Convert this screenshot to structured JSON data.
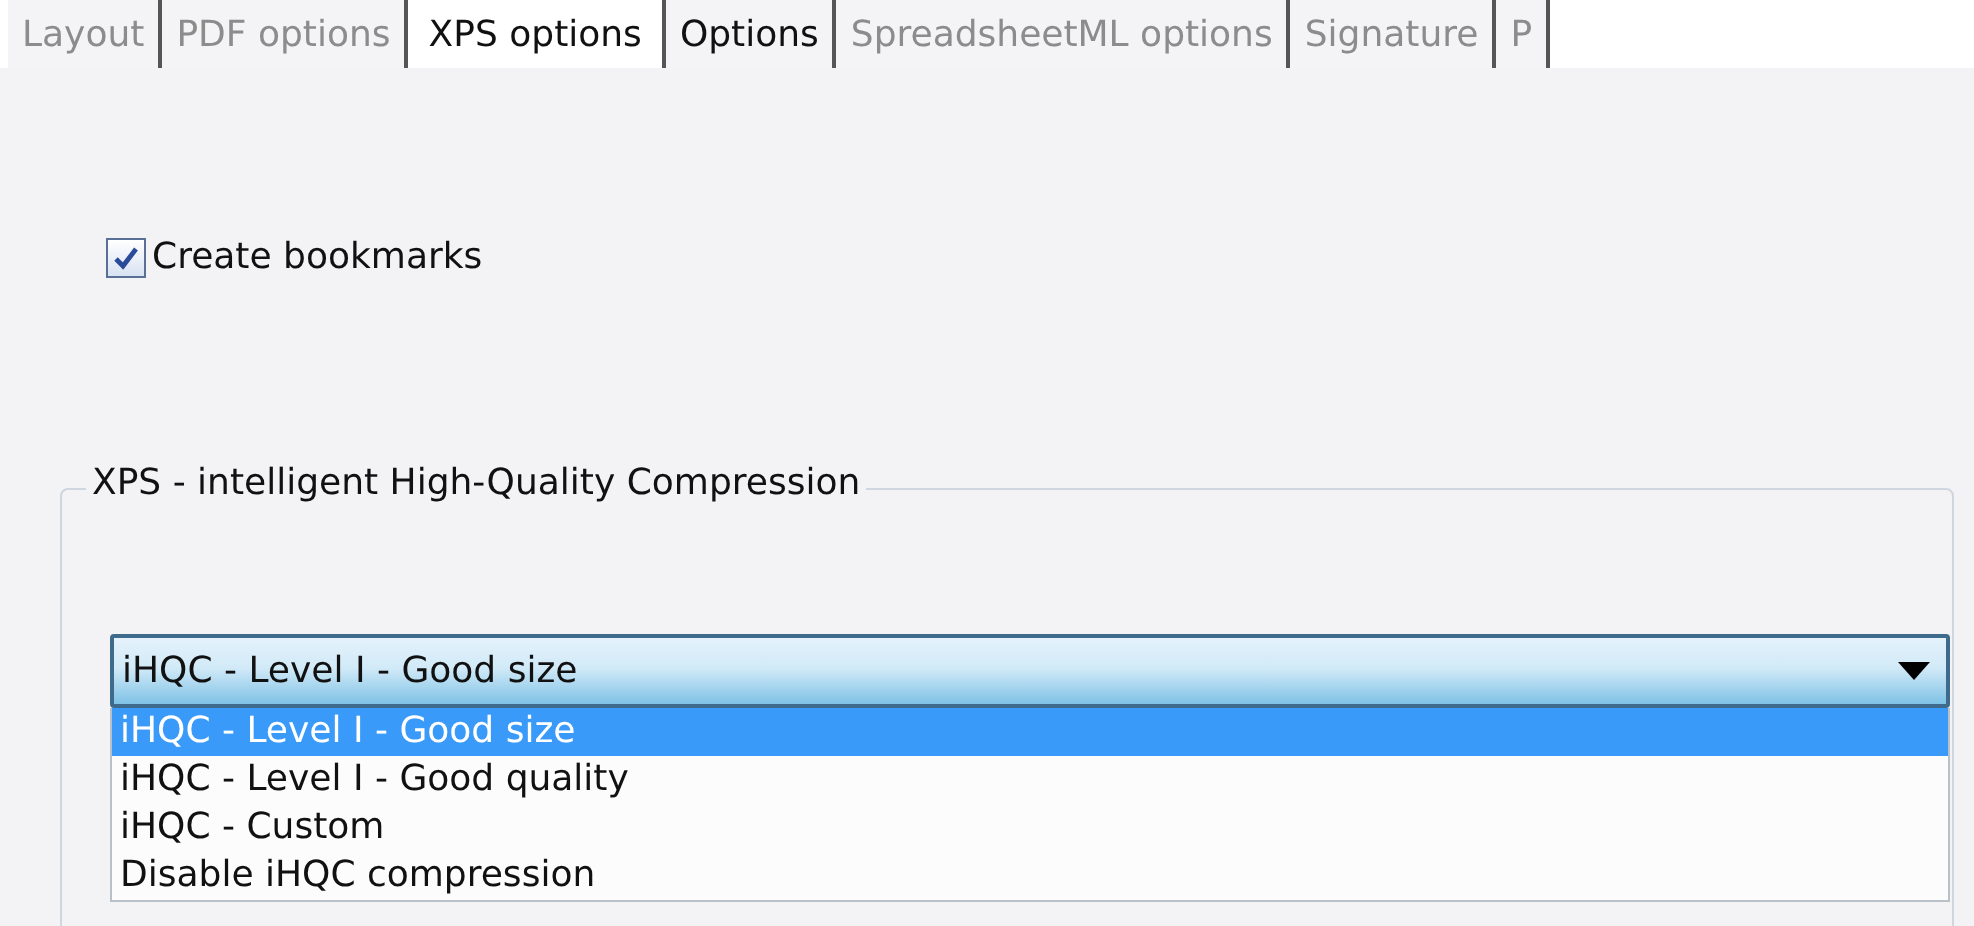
{
  "tabs": [
    {
      "label": "Layout",
      "selected": false,
      "disabled": true
    },
    {
      "label": "PDF options",
      "selected": false,
      "disabled": true
    },
    {
      "label": "XPS options",
      "selected": true,
      "disabled": false
    },
    {
      "label": "Options",
      "selected": false,
      "disabled": false
    },
    {
      "label": "SpreadsheetML options",
      "selected": false,
      "disabled": true
    },
    {
      "label": "Signature",
      "selected": false,
      "disabled": true
    },
    {
      "label": "P",
      "selected": false,
      "disabled": true
    }
  ],
  "create_bookmarks": {
    "label": "Create bookmarks",
    "checked": true
  },
  "compression_group": {
    "title": "XPS - intelligent High-Quality Compression",
    "dropdown": {
      "value": "iHQC - Level I - Good size",
      "expanded": true,
      "options": [
        {
          "label": "iHQC - Level I - Good size",
          "selected": true
        },
        {
          "label": "iHQC - Level I - Good quality",
          "selected": false
        },
        {
          "label": "iHQC - Custom",
          "selected": false
        },
        {
          "label": "Disable iHQC compression",
          "selected": false
        }
      ]
    }
  }
}
